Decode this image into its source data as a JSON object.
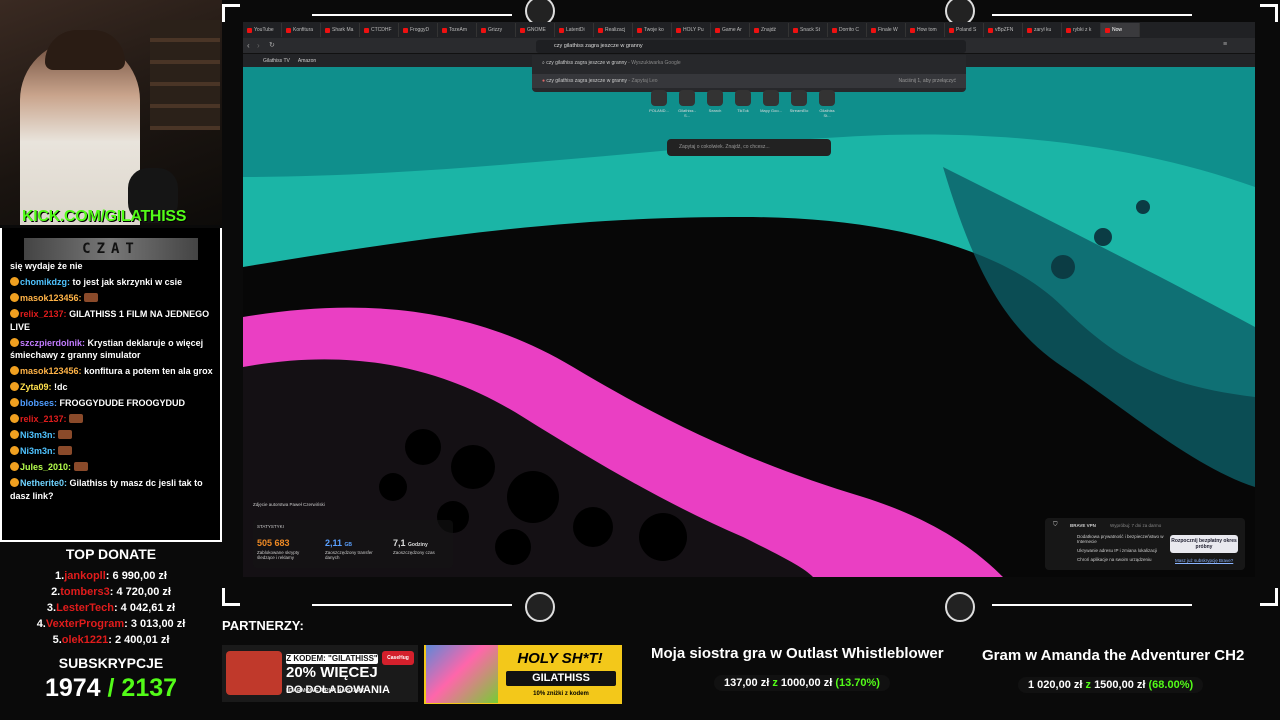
{
  "stream": {
    "kick_url": "KICK.COM/GILATHISS",
    "chat_header": "CZAT",
    "chat": [
      {
        "user": "",
        "user_color": "#ffffff",
        "text": "się wydaje że nie"
      },
      {
        "user": "chomikdzg:",
        "user_color": "#4fc3ff",
        "text": "to jest jak skrzynki w csie"
      },
      {
        "user": "masok123456:",
        "user_color": "#ffb347",
        "text": ""
      },
      {
        "user": "relix_2137:",
        "user_color": "#e01c1c",
        "text": "GILATHISS 1 FILM NA JEDNEGO LIVE"
      },
      {
        "user": "szczpierdolnik:",
        "user_color": "#c27cff",
        "text": "Krystian deklaruje o więcej śmiechawy z granny simulator"
      },
      {
        "user": "masok123456:",
        "user_color": "#ffb347",
        "text": "konfitura a potem ten ala grox"
      },
      {
        "user": "Zyta09:",
        "user_color": "#ffe14d",
        "text": "!dc"
      },
      {
        "user": "blobses:",
        "user_color": "#4f9dff",
        "text": "FROGGYDUDE FROOGYDUD"
      },
      {
        "user": "relix_2137:",
        "user_color": "#e01c1c",
        "text": ""
      },
      {
        "user": "Ni3m3n:",
        "user_color": "#4fc3ff",
        "text": ""
      },
      {
        "user": "Ni3m3n:",
        "user_color": "#4fc3ff",
        "text": ""
      },
      {
        "user": "Jules_2010:",
        "user_color": "#b6ff4d",
        "text": ""
      },
      {
        "user": "Netherite0:",
        "user_color": "#6fd3ff",
        "text": "Gilathiss ty masz dc jesli tak to dasz link?"
      }
    ],
    "top_donate": {
      "title": "TOP DONATE",
      "entries": [
        {
          "rank": "1.",
          "name": "jankopll",
          "amount": ": 6 990,00 zł"
        },
        {
          "rank": "2.",
          "name": "tombers3",
          "amount": ": 4 720,00 zł"
        },
        {
          "rank": "3.",
          "name": "LesterTech",
          "amount": ": 4 042,61 zł"
        },
        {
          "rank": "4.",
          "name": "VexterProgram",
          "amount": ": 3 013,00 zł"
        },
        {
          "rank": "5.",
          "name": "olek1221",
          "amount": ": 2 400,01 zł"
        }
      ]
    },
    "subs": {
      "title": "SUBSKRYPCJE",
      "current": "1974",
      "goal": "/ 2137"
    },
    "partners_label": "PARTNERZY:",
    "ad1": {
      "code": "Z KODEM: \"GILATHISS\"",
      "line1": "20% WIĘCEJ",
      "line2": "DO DOŁADOWANIA",
      "line3": "I DARMOWE 4 PLN NA START",
      "brand": "CaseHug"
    },
    "ad2": {
      "headline": "HOLY SH*T!",
      "code": "GILATHISS",
      "sub": "10% zniżki z kodem"
    },
    "goals": [
      {
        "title": "Moja siostra gra w Outlast Whistleblower",
        "current": "137,00 zł",
        "sep": "z",
        "target": "1000,00 zł",
        "pct": "(13.70%)"
      },
      {
        "title": "Gram w Amanda the Adventurer CH2",
        "current": "1 020,00 zł",
        "sep": "z",
        "target": "1500,00 zł",
        "pct": "(68.00%)"
      }
    ]
  },
  "browser": {
    "tabs": [
      "YouTube",
      "Konfitura",
      "Shark Ma",
      "CTCDHF",
      "FroggyD",
      "TozeAm",
      "Grizzy",
      "GNOME",
      "LatentDi",
      "Realizacj",
      "Twoje ko",
      "HOLY Pu",
      "Game Ar",
      "Znajdź",
      "Snack St",
      "Dorrito C",
      "Finale W",
      "How tom",
      "Poland S",
      "vBpZFN",
      "zarył ku",
      "rybki z k",
      "Now"
    ],
    "address": "czy gilathiss zagra jeszcze w granny",
    "bookmarks": [
      "Gilathiss TV",
      "Amazon"
    ],
    "suggestions": [
      {
        "text": "czy gilathiss zagra jeszcze w granny",
        "suffix": " - Wyszukiwarka Google"
      },
      {
        "text": "czy gilathiss zagra jeszcze w granny",
        "suffix": " - Zapytaj Leo",
        "hint": "Naciśnij 1, aby przełączyć"
      }
    ],
    "speed_dial": [
      "POLAND...",
      "Gilathiss - S...",
      "Search",
      "TikTok",
      "Mapy Goo...",
      "StreamElo",
      "Gilathiss St..."
    ],
    "leo_placeholder": "Zapytaj o cokolwiek. Znajdź, co chcesz...",
    "photo_credit": "Zdjęcie autorstwa Paweł Czerwiński",
    "stats": {
      "title": "STATYSTYKI",
      "items": [
        {
          "value": "505 683",
          "color": "#f08a24",
          "label": "Zablokowane skrypty śledzące i reklamy"
        },
        {
          "value": "2,11",
          "unit": "GB",
          "color": "#5aa0ff",
          "label": "Zaoszczędzony transfer danych"
        },
        {
          "value": "7,1",
          "unit": "Godziny",
          "color": "#dddddd",
          "label": "Zaoszczędzony czas"
        }
      ]
    },
    "vpn": {
      "title": "BRAVE VPN",
      "trial": "Wypróbuj: 7 dni za darmo",
      "features": [
        "Dodatkowa prywatność i bezpieczeństwo w Internecie",
        "Ukrywanie adresu IP i zmiana lokalizacji",
        "Chroń aplikacje na swoim urządzeniu"
      ],
      "cta": "Rozpocznij bezpłatny okres próbny",
      "link": "Masz już subskrypcję Brave?"
    }
  },
  "colors": {
    "kick_green": "#53fc18",
    "donor_red": "#e01c1c",
    "teal": "#1ec9b8",
    "magenta": "#ea3fc3"
  }
}
